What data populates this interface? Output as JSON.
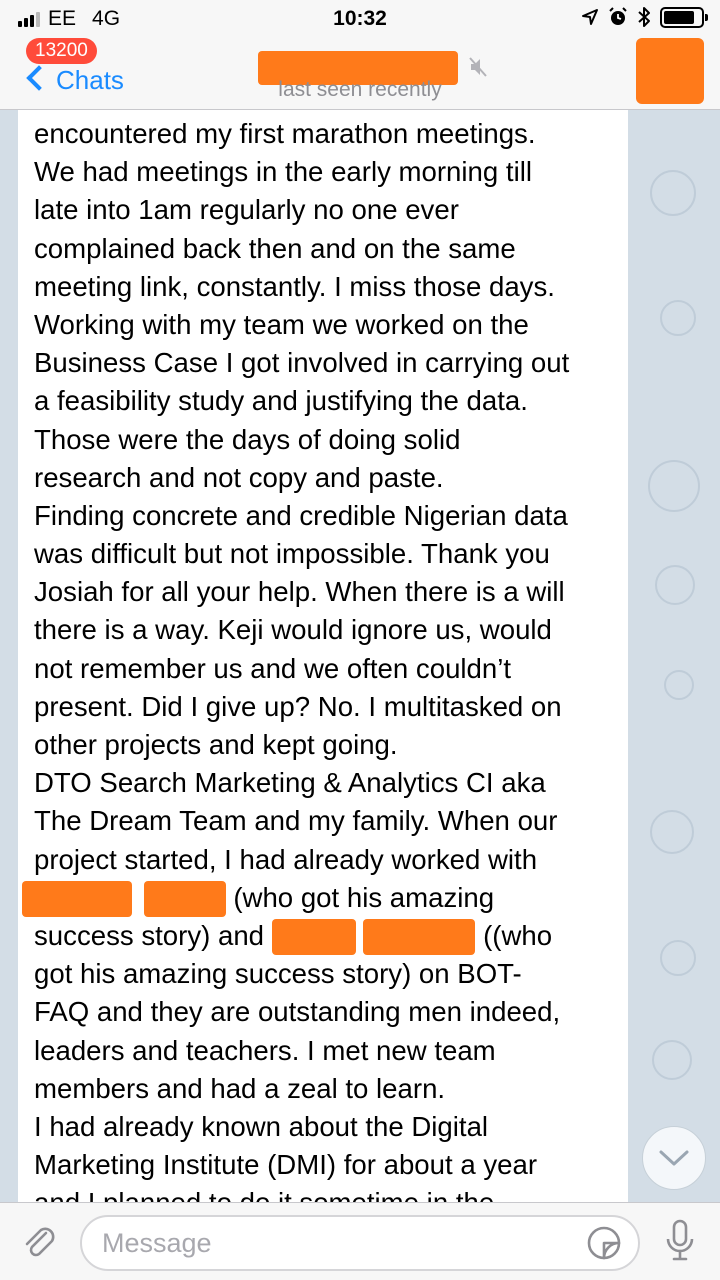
{
  "status_bar": {
    "carrier": "EE",
    "network": "4G",
    "time": "10:32"
  },
  "nav": {
    "back_label": "Chats",
    "unread_badge": "13200",
    "chat_status": "last seen recently"
  },
  "message_lines": [
    "encountered my first marathon meetings.",
    "We had meetings in the early morning till",
    "late into 1am regularly no one ever",
    "complained back then and on the same",
    "meeting link, constantly. I miss those days.",
    "Working with my team we worked on the",
    "Business Case I got involved in carrying out",
    "a feasibility study and justifying the data.",
    "Those were the days of doing solid",
    "research and not copy and paste.",
    "Finding concrete and credible Nigerian data",
    "was difficult but not impossible. Thank you",
    "Josiah for all your help. When there is a will",
    "there is a way. Keji would ignore us, would",
    "not remember us and we often couldn’t",
    "present. Did I give up? No. I multitasked on",
    "other projects and kept going.",
    "DTO Search Marketing & Analytics CI aka",
    "The Dream Team and my family. When our",
    "project started, I had already worked with"
  ],
  "redacted_line_1_text": "(who got his amazing",
  "redacted_line_2_prefix": "success story) and",
  "redacted_line_2_suffix": "((who",
  "message_lines_tail": [
    "got his amazing success story) on BOT-",
    "FAQ and they are outstanding men indeed,",
    "leaders and teachers. I met new team",
    "members and had a zeal to learn.",
    "I had already known about the Digital",
    "Marketing Institute (DMI) for about a year",
    "and I planned to do it sometime in the"
  ],
  "input": {
    "placeholder": "Message"
  },
  "colors": {
    "accent": "#1a8bff",
    "badge": "#ff4b3a",
    "redaction": "#ff7a1a",
    "chat_background": "#d3dde6"
  },
  "icons": [
    "signal-icon",
    "location-icon",
    "alarm-icon",
    "bluetooth-icon",
    "battery-icon",
    "mute-icon",
    "paperclip-icon",
    "sticker-icon",
    "microphone-icon",
    "chevron-down-icon"
  ]
}
